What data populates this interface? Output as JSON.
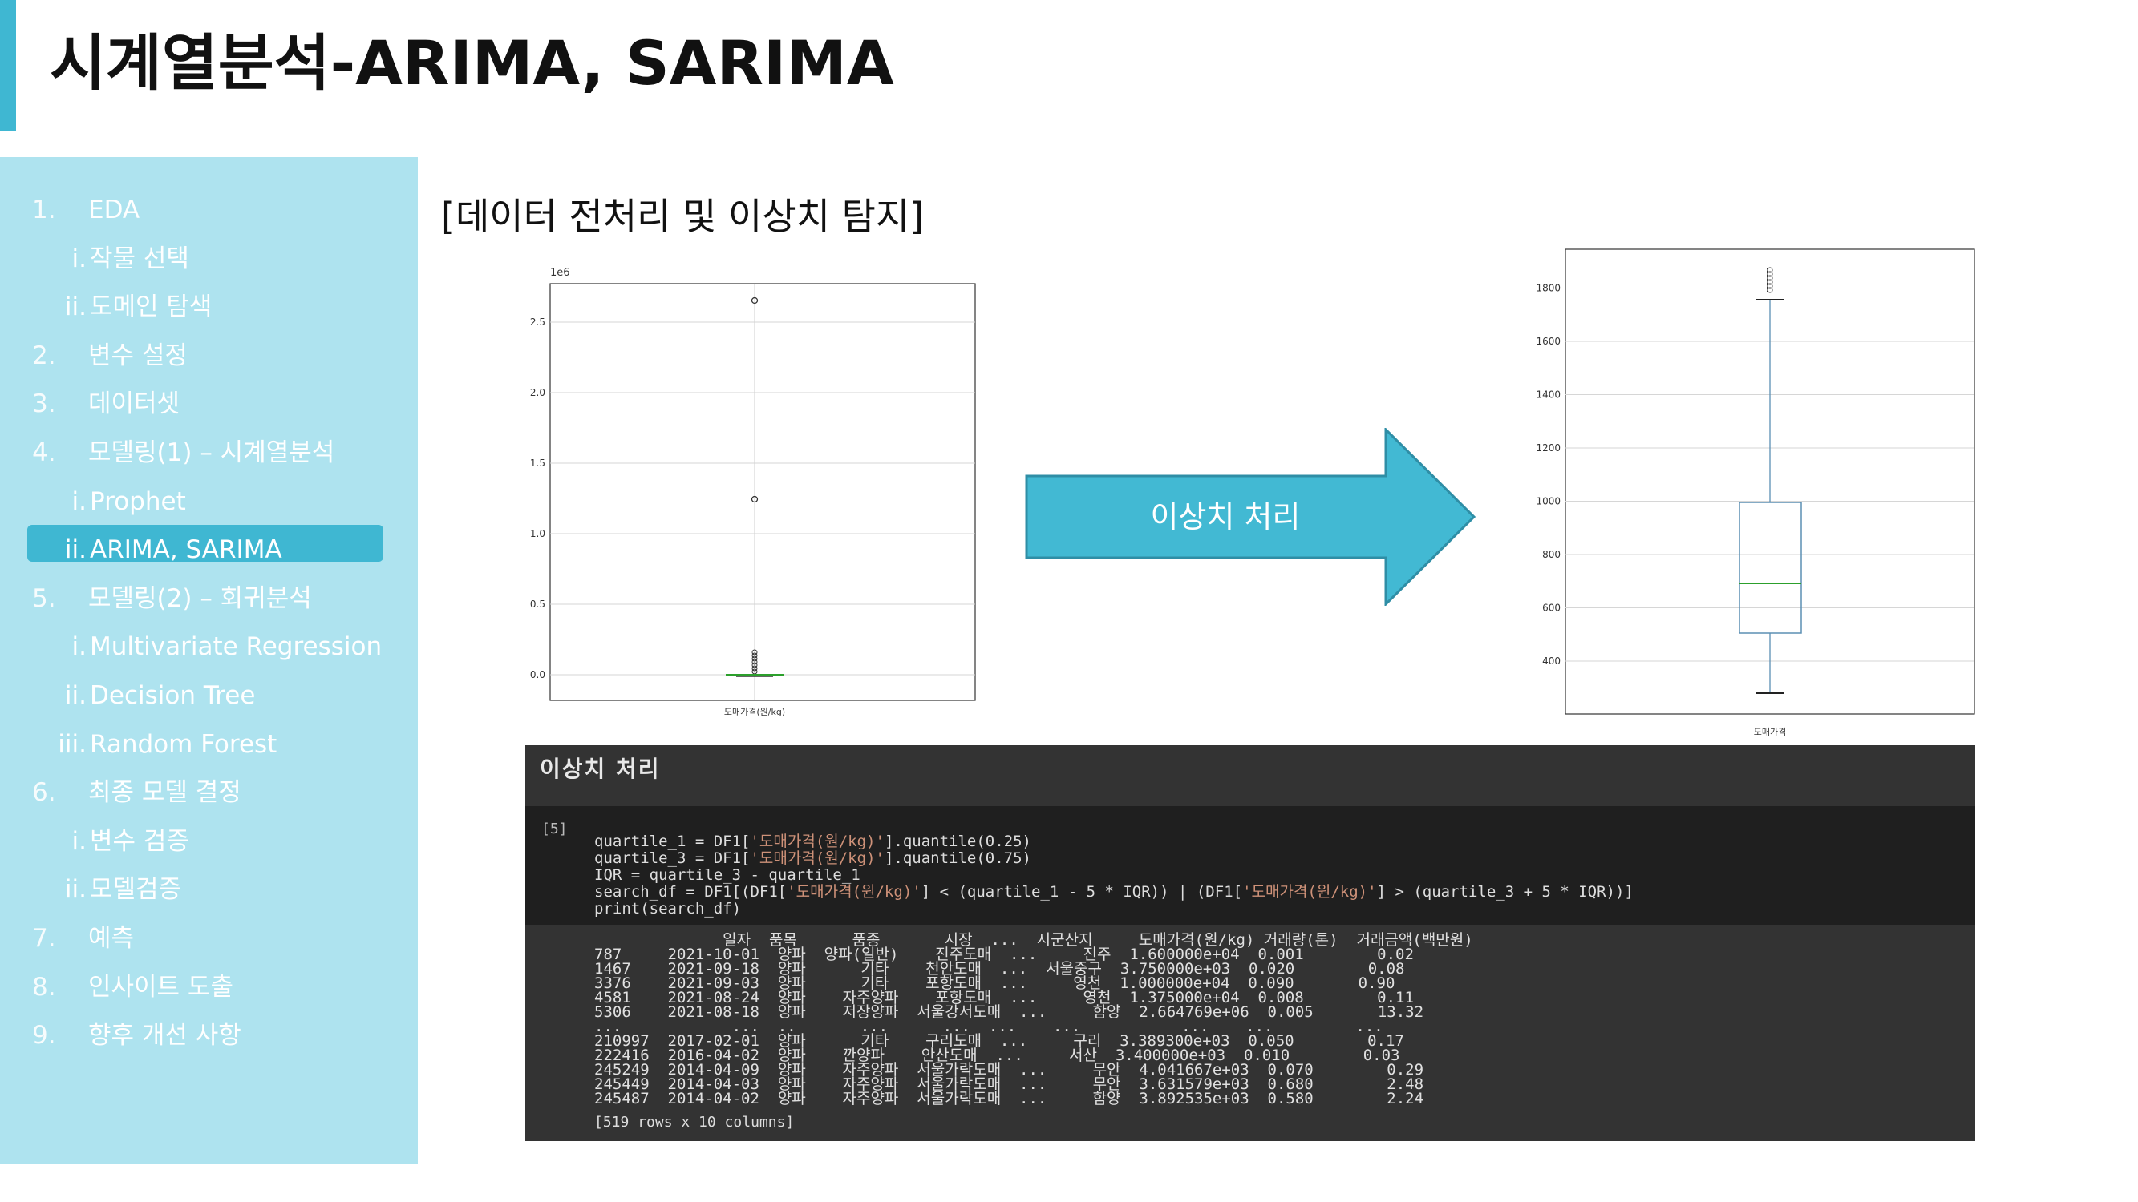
{
  "slide": {
    "title": "시계열분석-ARIMA, SARIMA",
    "accent_color": "#3fb7d2",
    "sidebar_color": "#aee3ef"
  },
  "sidebar": {
    "items": [
      {
        "num": "1.",
        "label": "EDA",
        "level": "top"
      },
      {
        "num": "i.",
        "label": "작물 선택",
        "level": "sub"
      },
      {
        "num": "ii.",
        "label": "도메인 탐색",
        "level": "sub"
      },
      {
        "num": "2.",
        "label": "변수 설정",
        "level": "top"
      },
      {
        "num": "3.",
        "label": "데이터셋",
        "level": "top"
      },
      {
        "num": "4.",
        "label": "모델링(1) – 시계열분석",
        "level": "top"
      },
      {
        "num": "i.",
        "label": "Prophet",
        "level": "sub"
      },
      {
        "num": "ii.",
        "label": "ARIMA, SARIMA",
        "level": "sub",
        "active": true
      },
      {
        "num": "5.",
        "label": "모델링(2) – 회귀분석",
        "level": "top"
      },
      {
        "num": "i.",
        "label": "Multivariate Regression",
        "level": "sub"
      },
      {
        "num": "ii.",
        "label": "Decision Tree",
        "level": "sub"
      },
      {
        "num": "iii.",
        "label": "Random Forest",
        "level": "sub"
      },
      {
        "num": "6.",
        "label": "최종 모델 결정",
        "level": "top"
      },
      {
        "num": "i.",
        "label": "변수 검증",
        "level": "sub"
      },
      {
        "num": "ii.",
        "label": "모델검증",
        "level": "sub"
      },
      {
        "num": "7.",
        "label": "예측",
        "level": "top"
      },
      {
        "num": "8.",
        "label": "인사이트 도출",
        "level": "top"
      },
      {
        "num": "9.",
        "label": "향후 개선 사항",
        "level": "top"
      }
    ]
  },
  "main": {
    "heading": "[데이터 전처리 및 이상치 탐지]",
    "arrow_label": "이상치 처리",
    "arrow_color": "#42b9d3"
  },
  "left_plot": {
    "offset_label": "1e6",
    "yticks": [
      "0.0",
      "0.5",
      "1.0",
      "1.5",
      "2.0",
      "2.5"
    ],
    "xtick": "도매가격(원/kg)"
  },
  "right_plot": {
    "yticks": [
      "400",
      "600",
      "800",
      "1000",
      "1200",
      "1400",
      "1600",
      "1800"
    ],
    "xtick": "도매가격"
  },
  "code": {
    "title": "이상치 처리",
    "cell_num": "[5]",
    "lines": [
      "quartile_1 = DF1['도매가격(원/kg)'].quantile(0.25)",
      "quartile_3 = DF1['도매가격(원/kg)'].quantile(0.75)",
      "IQR = quartile_3 - quartile_1",
      "search_df = DF1[(DF1['도매가격(원/kg)'] < (quartile_1 - 5 * IQR)) | (DF1['도매가격(원/kg)'] > (quartile_3 + 5 * IQR))]",
      "print(search_df)"
    ],
    "output": [
      "              일자  품목      품종       시장  ...  시군산지     도매가격(원/kg) 거래량(톤)  거래금액(백만원)",
      "787     2021-10-01  양파  양파(일반)    진주도매  ...     진주  1.600000e+04  0.001        0.02",
      "1467    2021-09-18  양파      기타    천안도매  ...  서울중구  3.750000e+03  0.020        0.08",
      "3376    2021-09-03  양파      기타    포항도매  ...     영천  1.000000e+04  0.090       0.90",
      "4581    2021-08-24  양파    자주양파    포항도매  ...     영천  1.375000e+04  0.008        0.11",
      "5306    2021-08-18  양파    저장양파  서울강서도매  ...     함양  2.664769e+06  0.005       13.32",
      "...            ...  ..       ...      ...  ...    ...           ...    ...         ...",
      "210997  2017-02-01  양파      기타    구리도매  ...     구리  3.389300e+03  0.050        0.17",
      "222416  2016-04-02  양파    깐양파    안산도매  ...     서산  3.400000e+03  0.010        0.03",
      "245249  2014-04-09  양파    자주양파  서울가락도매  ...     무안  4.041667e+03  0.070        0.29",
      "245449  2014-04-03  양파    자주양파  서울가락도매  ...     무안  3.631579e+03  0.680        2.48",
      "245487  2014-04-02  양파    자주양파  서울가락도매  ...     함양  3.892535e+03  0.580        2.24"
    ],
    "footer": "[519 rows x 10 columns]"
  }
}
